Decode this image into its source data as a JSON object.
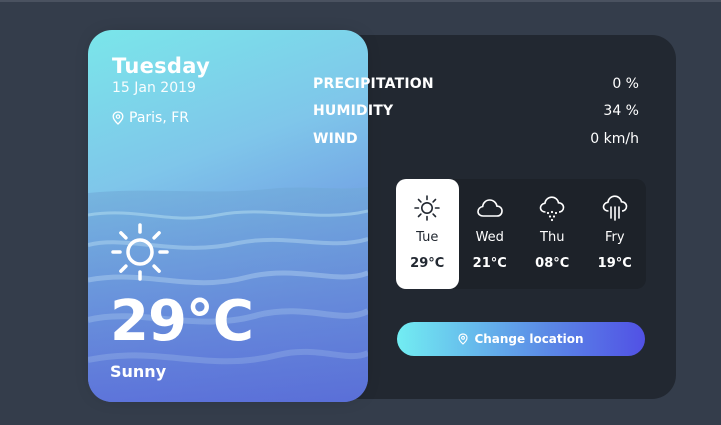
{
  "weather": {
    "day": "Tuesday",
    "date": "15 Jan 2019",
    "location": "Paris, FR",
    "temperature": "29°C",
    "description": "Sunny",
    "icon": "sun-icon"
  },
  "stats": [
    {
      "title": "PRECIPITATION",
      "value": "0 %"
    },
    {
      "title": "HUMIDITY",
      "value": "34 %"
    },
    {
      "title": "WIND",
      "value": "0 km/h"
    }
  ],
  "week": [
    {
      "day": "Tue",
      "temp": "29°C",
      "icon": "sun-icon",
      "active": true
    },
    {
      "day": "Wed",
      "temp": "21°C",
      "icon": "cloud-icon",
      "active": false
    },
    {
      "day": "Thu",
      "temp": "08°C",
      "icon": "snow-cloud-icon",
      "active": false
    },
    {
      "day": "Fry",
      "temp": "19°C",
      "icon": "rain-cloud-icon",
      "active": false
    }
  ],
  "button": {
    "label": "Change location",
    "icon": "location-pin-icon"
  },
  "colors": {
    "background": "#343d4b",
    "panel": "#222831",
    "gradient_start": "#72edf2",
    "gradient_end": "#5151e5"
  }
}
